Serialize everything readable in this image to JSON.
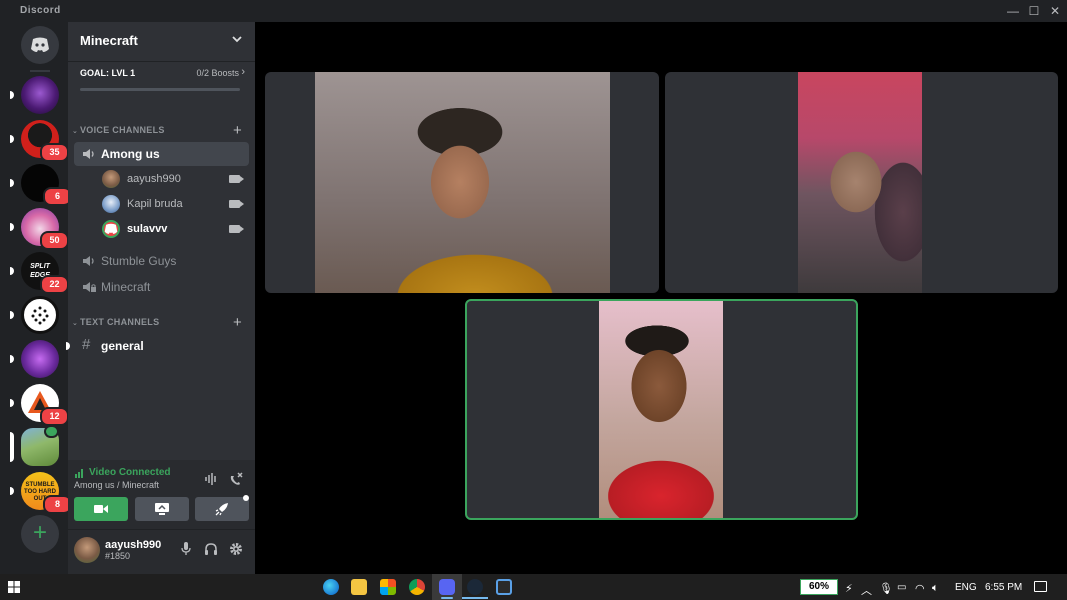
{
  "window": {
    "title": "Discord",
    "controls": [
      "—",
      "☐",
      "✕"
    ]
  },
  "rail": {
    "servers": [
      {
        "name": "home",
        "badge": ""
      },
      {
        "name": "server-1",
        "badge": ""
      },
      {
        "name": "server-2",
        "badge": "35"
      },
      {
        "name": "server-3",
        "badge": "6"
      },
      {
        "name": "server-4",
        "badge": "50"
      },
      {
        "name": "server-5",
        "badge": "22",
        "label": "SPLIT EDGE"
      },
      {
        "name": "server-6",
        "badge": ""
      },
      {
        "name": "server-7",
        "badge": ""
      },
      {
        "name": "server-8",
        "badge": "12"
      },
      {
        "name": "server-9",
        "badge": ""
      },
      {
        "name": "server-10",
        "badge": "8",
        "label": "STUMBLE TOO HARD OUT"
      }
    ],
    "add_label": "+"
  },
  "guild": {
    "name": "Minecraft",
    "goal_label": "GOAL: LVL 1",
    "boosts_label": "0/2 Boosts",
    "boosts_chevron": "›"
  },
  "categories": {
    "voice": "VOICE CHANNELS",
    "text": "TEXT CHANNELS"
  },
  "channels": {
    "among_us": "Among us",
    "stumble_guys": "Stumble Guys",
    "minecraft": "Minecraft",
    "general": "general"
  },
  "voice_users": [
    {
      "name": "aayush990"
    },
    {
      "name": "Kapil bruda"
    },
    {
      "name": "sulavvv"
    }
  ],
  "voice_panel": {
    "status": "Video Connected",
    "location": "Among us / Minecraft"
  },
  "user_panel": {
    "username": "aayush990",
    "tag": "#1850"
  },
  "taskbar": {
    "battery": "60%",
    "language": "ENG",
    "time": "6:55 PM"
  },
  "colors": {
    "green": "#3ba55d",
    "red_badge": "#ed4245",
    "sidebar": "#2f3136",
    "rail": "#202225"
  }
}
